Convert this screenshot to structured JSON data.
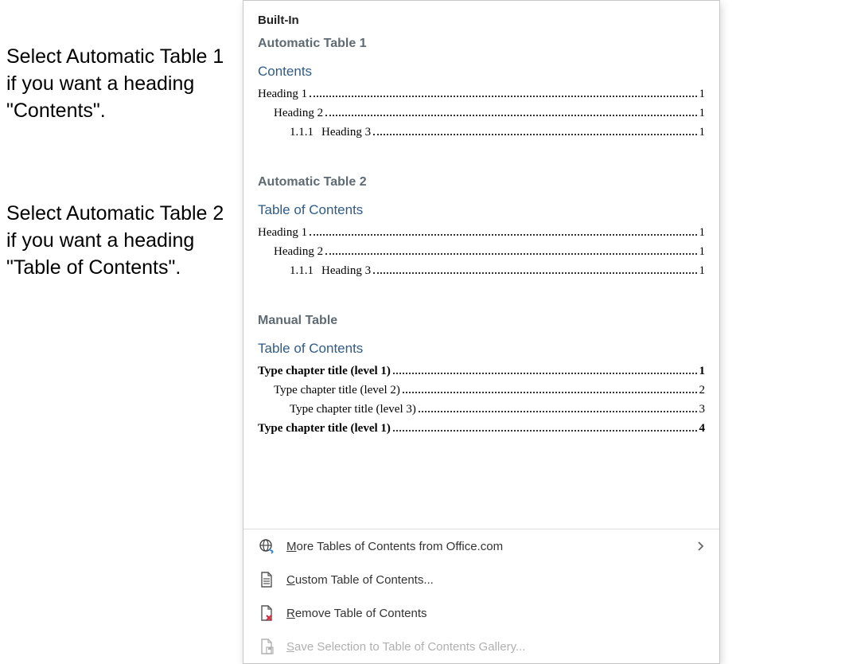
{
  "instructions": {
    "a": "Select Automatic Table 1 if you want a heading \"Contents\".",
    "b": "Select Automatic Table 2 if you want a heading \"Table of Contents\"."
  },
  "dropdown": {
    "section_header": "Built-In",
    "auto1": {
      "style_name": "Automatic Table 1",
      "title": "Contents",
      "rows": {
        "r1": {
          "label": "Heading 1",
          "page": "1"
        },
        "r2": {
          "label": "Heading 2",
          "page": "1"
        },
        "r3": {
          "prefix": "1.1.1",
          "label": "Heading 3",
          "page": "1"
        }
      }
    },
    "auto2": {
      "style_name": "Automatic Table 2",
      "title": "Table of Contents",
      "rows": {
        "r1": {
          "label": "Heading 1",
          "page": "1"
        },
        "r2": {
          "label": "Heading 2",
          "page": "1"
        },
        "r3": {
          "prefix": "1.1.1",
          "label": "Heading 3",
          "page": "1"
        }
      }
    },
    "manual": {
      "style_name": "Manual Table",
      "title": "Table of Contents",
      "rows": {
        "r1": {
          "label": "Type chapter title (level 1)",
          "page": "1"
        },
        "r2": {
          "label": "Type chapter title (level 2)",
          "page": "2"
        },
        "r3": {
          "label": "Type chapter title (level 3)",
          "page": "3"
        },
        "r4": {
          "label": "Type chapter title (level 1)",
          "page": "4"
        }
      }
    },
    "menu": {
      "more": "More Tables of Contents from Office.com",
      "custom": "Custom Table of Contents...",
      "remove": "Remove Table of Contents",
      "save": "Save Selection to Table of Contents Gallery..."
    }
  }
}
